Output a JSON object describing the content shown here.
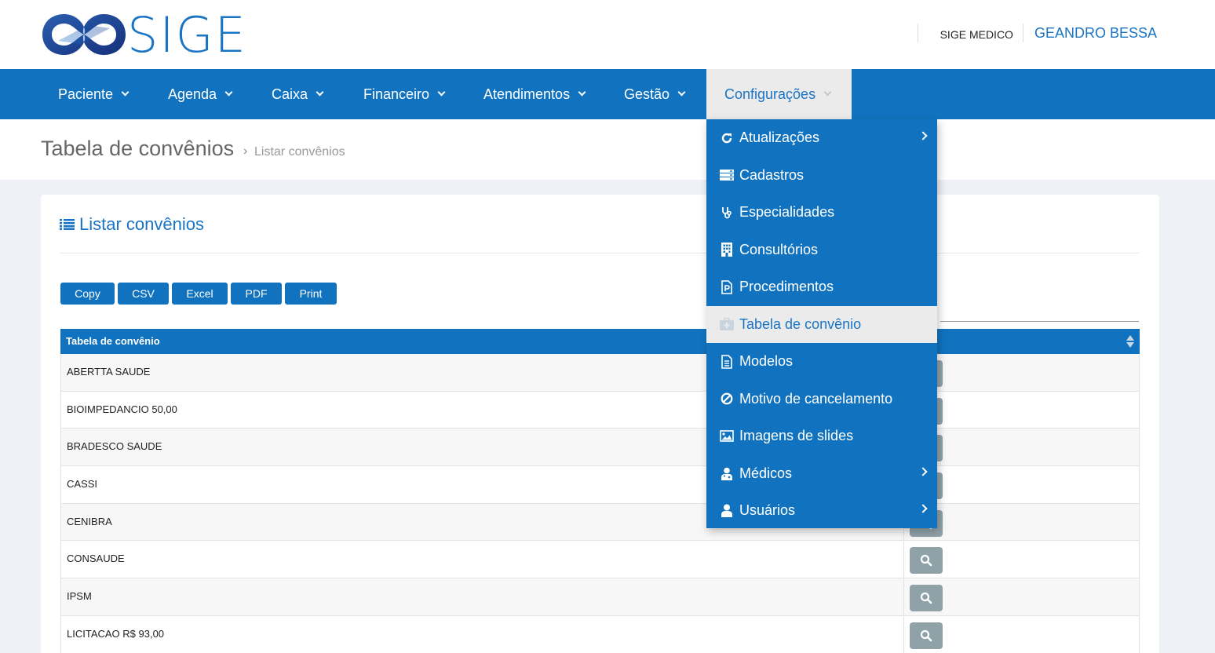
{
  "brand": {
    "name": "SIGE",
    "primary_color": "#1173bf",
    "accent_color": "#1a74c4"
  },
  "header": {
    "company": "SIGE MEDICO",
    "user": "GEANDRO BESSA"
  },
  "nav": {
    "items": [
      {
        "label": "Paciente"
      },
      {
        "label": "Agenda"
      },
      {
        "label": "Caixa"
      },
      {
        "label": "Financeiro"
      },
      {
        "label": "Atendimentos"
      },
      {
        "label": "Gestão"
      },
      {
        "label": "Configurações",
        "active": true
      }
    ]
  },
  "page": {
    "title": "Tabela de convênios",
    "breadcrumb_separator": "›",
    "breadcrumb": "Listar convênios"
  },
  "card": {
    "title": "Listar convênios",
    "title_icon": "list-icon"
  },
  "export_buttons": [
    "Copy",
    "CSV",
    "Excel",
    "PDF",
    "Print"
  ],
  "table": {
    "columns": [
      "Tabela de convênio",
      ""
    ],
    "rows": [
      "ABERTTA SAUDE",
      "BIOIMPEDANCIO 50,00",
      "BRADESCO SAUDE",
      "CASSI",
      "CENIBRA",
      "CONSAUDE",
      "IPSM",
      "LICITACAO R$ 93,00"
    ],
    "row_action_icon": "search-icon"
  },
  "dropdown": {
    "items": [
      {
        "label": "Atualizações",
        "icon": "refresh-icon",
        "submenu": true
      },
      {
        "label": "Cadastros",
        "icon": "server-icon",
        "submenu": false
      },
      {
        "label": "Especialidades",
        "icon": "stethoscope-icon",
        "submenu": false
      },
      {
        "label": "Consultórios",
        "icon": "building-icon",
        "submenu": false
      },
      {
        "label": "Procedimentos",
        "icon": "file-p-icon",
        "submenu": false
      },
      {
        "label": "Tabela de convênio",
        "icon": "medkit-icon",
        "submenu": false,
        "active": true
      },
      {
        "label": "Modelos",
        "icon": "file-text-icon",
        "submenu": false
      },
      {
        "label": "Motivo de cancelamento",
        "icon": "ban-icon",
        "submenu": false
      },
      {
        "label": "Imagens de slides",
        "icon": "image-icon",
        "submenu": false
      },
      {
        "label": "Médicos",
        "icon": "user-md-icon",
        "submenu": true
      },
      {
        "label": "Usuários",
        "icon": "user-icon",
        "submenu": true
      }
    ]
  }
}
